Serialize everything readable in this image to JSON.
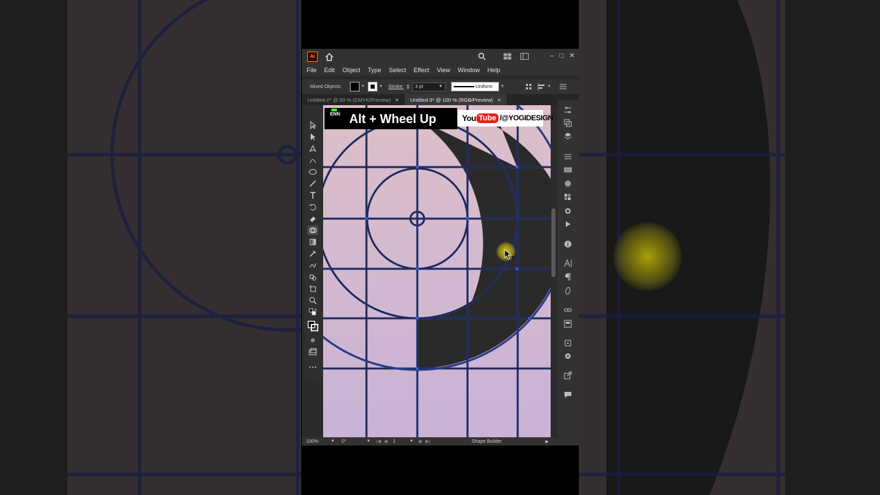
{
  "window": {
    "app_logo": "Ai",
    "controls": [
      "–",
      "□",
      "✕"
    ]
  },
  "menu": [
    "File",
    "Edit",
    "Object",
    "Type",
    "Select",
    "Effect",
    "View",
    "Window",
    "Help"
  ],
  "control_bar": {
    "selection_label": "Mixed Objects",
    "stroke_label": "Stroke:",
    "stroke_weight": "3 pt",
    "profile_label": "Uniform"
  },
  "tabs": [
    {
      "label": "Untitled-2* @ 50 % (CMYK/Preview)",
      "active": false
    },
    {
      "label": "Untitled-3* @ 100 % (RGB/Preview)",
      "active": true
    }
  ],
  "status_bar": {
    "zoom": "100%",
    "rotation": "0°",
    "artboard": "1",
    "tool_name": "Shape Builder"
  },
  "overlay": {
    "language": "ENN",
    "shortcut": "Alt + Wheel Up",
    "yt_you": "You",
    "yt_tube": "Tube",
    "yt_handle": "/@YOGIDESIGN"
  },
  "icons": {
    "tools": [
      "selection-arrow",
      "direct-selection",
      "pen",
      "curvature",
      "ellipse",
      "paintbrush",
      "type",
      "rotate",
      "eraser",
      "shape-builder",
      "gradient",
      "eyedropper",
      "blend",
      "live-paint",
      "artboard",
      "zoom",
      "default-colors",
      "swap-colors",
      "fill-stroke",
      "draw-mode",
      "screen-mode",
      "more-tools"
    ],
    "panels": [
      "properties",
      "libraries",
      "layers",
      "align",
      "gradient-panel",
      "color",
      "swatches",
      "symbols",
      "actions",
      "info",
      "character",
      "paragraph",
      "opentype",
      "links",
      "asset-export",
      "transform",
      "appearance",
      "export",
      "comments"
    ]
  },
  "colors": {
    "canvas_top": "#dcbfc8",
    "canvas_bottom": "#c9b3d6",
    "grid_line": "#2b3a8a",
    "shape_fill": "#2a2a2a",
    "ui_dark": "#2b2b2b",
    "accent_yellow": "#ffe600"
  }
}
